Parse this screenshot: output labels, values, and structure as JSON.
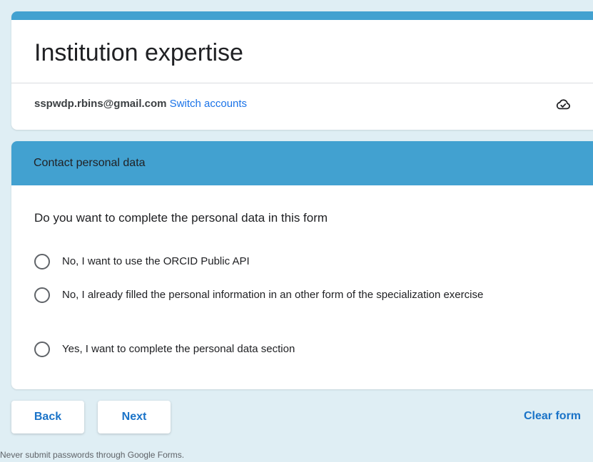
{
  "form": {
    "title": "Institution expertise",
    "account_email": "sspwdp.rbins@gmail.com",
    "switch_accounts": "Switch accounts",
    "save_status_icon": "cloud-check-icon"
  },
  "section": {
    "title": "Contact personal data",
    "question": "Do you want to complete the personal data in this form",
    "options": [
      {
        "label": "No, I want to use the ORCID Public API",
        "selected": false
      },
      {
        "label": "No, I already filled the personal information in an other form of the specialization exercise",
        "selected": false
      },
      {
        "label": "Yes, I want to complete the personal data section",
        "selected": false
      }
    ]
  },
  "navigation": {
    "back_label": "Back",
    "next_label": "Next",
    "clear_label": "Clear form"
  },
  "footer": {
    "note": "Never submit passwords through Google Forms."
  },
  "colors": {
    "accent": "#42a1d0",
    "background": "#dfeef4",
    "link": "#1a73e8",
    "button_text": "#1a73c8"
  }
}
